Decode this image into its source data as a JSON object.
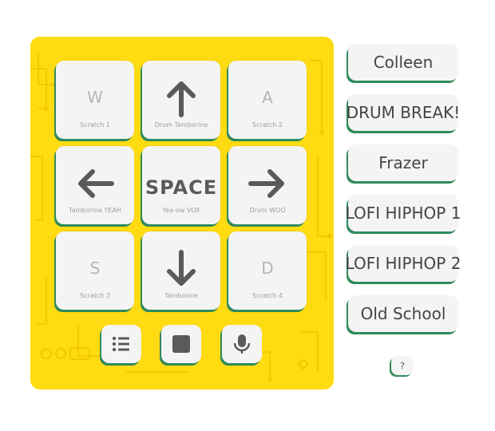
{
  "pads": [
    {
      "key": "W",
      "label": "Scratch 1"
    },
    {
      "arrow": "up-arrow-icon",
      "label": "Drum Tamborine"
    },
    {
      "key": "A",
      "label": "Scratch 2"
    },
    {
      "arrow": "left-arrow-icon",
      "label": "Tamborine YEAH"
    },
    {
      "key": "SPACE",
      "label": "Yea-ow VOX"
    },
    {
      "arrow": "right-arrow-icon",
      "label": "Drum WOO"
    },
    {
      "key": "S",
      "label": "Scratch 3"
    },
    {
      "arrow": "down-arrow-icon",
      "label": "Tamborine"
    },
    {
      "key": "D",
      "label": "Scratch 4"
    }
  ],
  "controls": {
    "list_icon": "list-icon",
    "stop_icon": "stop-icon",
    "mic_icon": "microphone-icon"
  },
  "presets": [
    "Colleen",
    "DRUM BREAK!",
    "Frazer",
    "LOFI HIPHOP 1",
    "LOFI HIPHOP 2",
    "Old School"
  ],
  "help": {
    "label": "?"
  },
  "colors": {
    "board": "#ffdb12",
    "pad": "#f4f4f4",
    "pad_shadow": "#2f8a5b",
    "icon": "#5a5a5a"
  }
}
